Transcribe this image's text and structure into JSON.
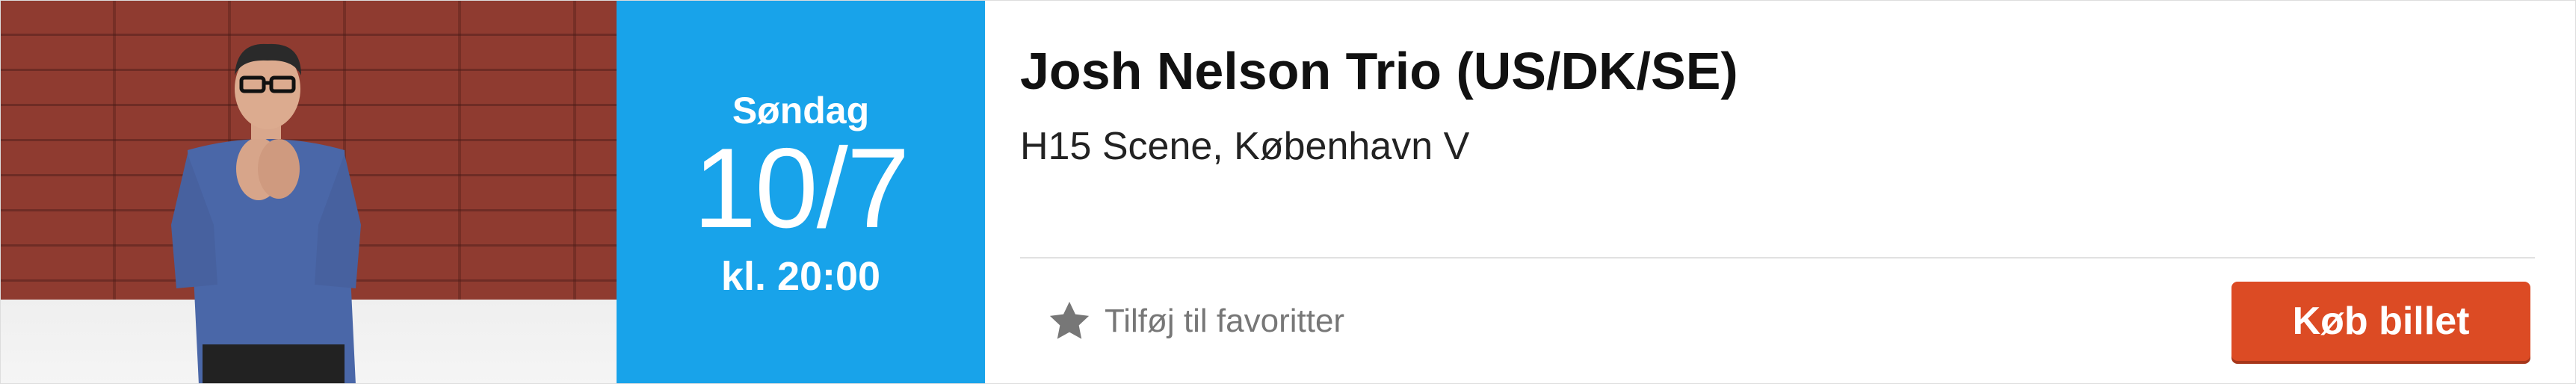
{
  "event": {
    "title": "Josh Nelson Trio (US/DK/SE)",
    "venue": "H15 Scene, København V",
    "weekday": "Søndag",
    "date": "10/7",
    "time": "kl. 20:00"
  },
  "actions": {
    "favorite_label": "Tilføj til favoritter",
    "buy_label": "Køb billet"
  },
  "colors": {
    "date_panel": "#18a3ea",
    "buy_button": "#dc4b24",
    "favorite_icon": "#777777"
  },
  "icons": {
    "favorite": "star-icon"
  }
}
